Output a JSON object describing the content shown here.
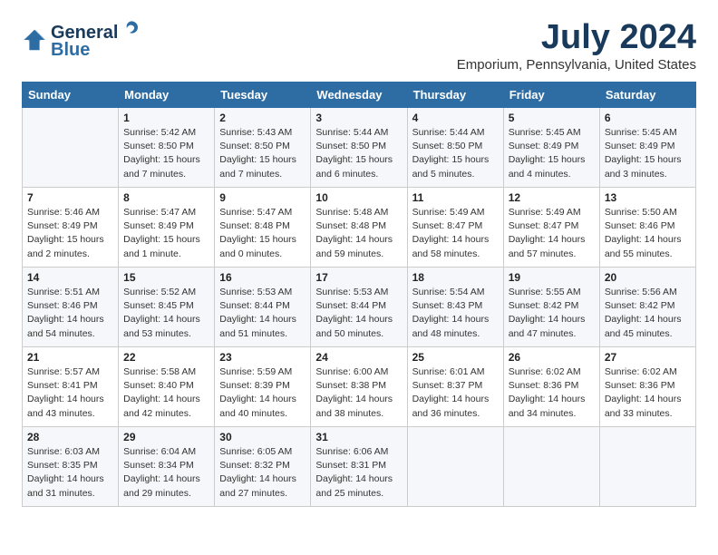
{
  "header": {
    "logo_text_general": "General",
    "logo_text_blue": "Blue",
    "month": "July 2024",
    "location": "Emporium, Pennsylvania, United States"
  },
  "weekdays": [
    "Sunday",
    "Monday",
    "Tuesday",
    "Wednesday",
    "Thursday",
    "Friday",
    "Saturday"
  ],
  "weeks": [
    [
      {
        "day": "",
        "info": ""
      },
      {
        "day": "1",
        "info": "Sunrise: 5:42 AM\nSunset: 8:50 PM\nDaylight: 15 hours\nand 7 minutes."
      },
      {
        "day": "2",
        "info": "Sunrise: 5:43 AM\nSunset: 8:50 PM\nDaylight: 15 hours\nand 7 minutes."
      },
      {
        "day": "3",
        "info": "Sunrise: 5:44 AM\nSunset: 8:50 PM\nDaylight: 15 hours\nand 6 minutes."
      },
      {
        "day": "4",
        "info": "Sunrise: 5:44 AM\nSunset: 8:50 PM\nDaylight: 15 hours\nand 5 minutes."
      },
      {
        "day": "5",
        "info": "Sunrise: 5:45 AM\nSunset: 8:49 PM\nDaylight: 15 hours\nand 4 minutes."
      },
      {
        "day": "6",
        "info": "Sunrise: 5:45 AM\nSunset: 8:49 PM\nDaylight: 15 hours\nand 3 minutes."
      }
    ],
    [
      {
        "day": "7",
        "info": "Sunrise: 5:46 AM\nSunset: 8:49 PM\nDaylight: 15 hours\nand 2 minutes."
      },
      {
        "day": "8",
        "info": "Sunrise: 5:47 AM\nSunset: 8:49 PM\nDaylight: 15 hours\nand 1 minute."
      },
      {
        "day": "9",
        "info": "Sunrise: 5:47 AM\nSunset: 8:48 PM\nDaylight: 15 hours\nand 0 minutes."
      },
      {
        "day": "10",
        "info": "Sunrise: 5:48 AM\nSunset: 8:48 PM\nDaylight: 14 hours\nand 59 minutes."
      },
      {
        "day": "11",
        "info": "Sunrise: 5:49 AM\nSunset: 8:47 PM\nDaylight: 14 hours\nand 58 minutes."
      },
      {
        "day": "12",
        "info": "Sunrise: 5:49 AM\nSunset: 8:47 PM\nDaylight: 14 hours\nand 57 minutes."
      },
      {
        "day": "13",
        "info": "Sunrise: 5:50 AM\nSunset: 8:46 PM\nDaylight: 14 hours\nand 55 minutes."
      }
    ],
    [
      {
        "day": "14",
        "info": "Sunrise: 5:51 AM\nSunset: 8:46 PM\nDaylight: 14 hours\nand 54 minutes."
      },
      {
        "day": "15",
        "info": "Sunrise: 5:52 AM\nSunset: 8:45 PM\nDaylight: 14 hours\nand 53 minutes."
      },
      {
        "day": "16",
        "info": "Sunrise: 5:53 AM\nSunset: 8:44 PM\nDaylight: 14 hours\nand 51 minutes."
      },
      {
        "day": "17",
        "info": "Sunrise: 5:53 AM\nSunset: 8:44 PM\nDaylight: 14 hours\nand 50 minutes."
      },
      {
        "day": "18",
        "info": "Sunrise: 5:54 AM\nSunset: 8:43 PM\nDaylight: 14 hours\nand 48 minutes."
      },
      {
        "day": "19",
        "info": "Sunrise: 5:55 AM\nSunset: 8:42 PM\nDaylight: 14 hours\nand 47 minutes."
      },
      {
        "day": "20",
        "info": "Sunrise: 5:56 AM\nSunset: 8:42 PM\nDaylight: 14 hours\nand 45 minutes."
      }
    ],
    [
      {
        "day": "21",
        "info": "Sunrise: 5:57 AM\nSunset: 8:41 PM\nDaylight: 14 hours\nand 43 minutes."
      },
      {
        "day": "22",
        "info": "Sunrise: 5:58 AM\nSunset: 8:40 PM\nDaylight: 14 hours\nand 42 minutes."
      },
      {
        "day": "23",
        "info": "Sunrise: 5:59 AM\nSunset: 8:39 PM\nDaylight: 14 hours\nand 40 minutes."
      },
      {
        "day": "24",
        "info": "Sunrise: 6:00 AM\nSunset: 8:38 PM\nDaylight: 14 hours\nand 38 minutes."
      },
      {
        "day": "25",
        "info": "Sunrise: 6:01 AM\nSunset: 8:37 PM\nDaylight: 14 hours\nand 36 minutes."
      },
      {
        "day": "26",
        "info": "Sunrise: 6:02 AM\nSunset: 8:36 PM\nDaylight: 14 hours\nand 34 minutes."
      },
      {
        "day": "27",
        "info": "Sunrise: 6:02 AM\nSunset: 8:36 PM\nDaylight: 14 hours\nand 33 minutes."
      }
    ],
    [
      {
        "day": "28",
        "info": "Sunrise: 6:03 AM\nSunset: 8:35 PM\nDaylight: 14 hours\nand 31 minutes."
      },
      {
        "day": "29",
        "info": "Sunrise: 6:04 AM\nSunset: 8:34 PM\nDaylight: 14 hours\nand 29 minutes."
      },
      {
        "day": "30",
        "info": "Sunrise: 6:05 AM\nSunset: 8:32 PM\nDaylight: 14 hours\nand 27 minutes."
      },
      {
        "day": "31",
        "info": "Sunrise: 6:06 AM\nSunset: 8:31 PM\nDaylight: 14 hours\nand 25 minutes."
      },
      {
        "day": "",
        "info": ""
      },
      {
        "day": "",
        "info": ""
      },
      {
        "day": "",
        "info": ""
      }
    ]
  ]
}
